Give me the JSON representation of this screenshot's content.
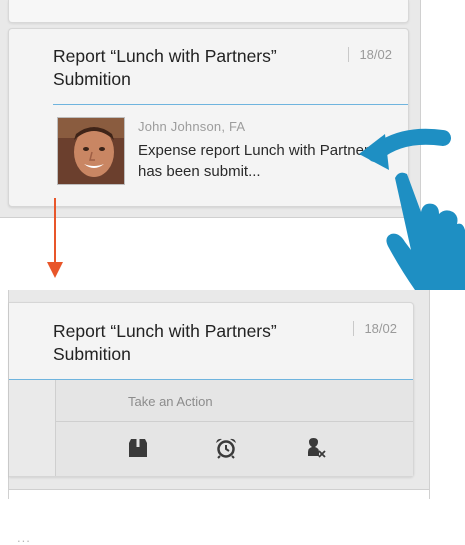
{
  "card_title": "Report “Lunch with Partners” Submition",
  "card_date": "18/02",
  "sender": "John Johnson, FA",
  "message": "Expense report Lunch with Partners has been submit...",
  "actions_panel": {
    "title": "Take an Action",
    "overflow": "...",
    "buttons": [
      {
        "name": "archive-icon"
      },
      {
        "name": "alarm-clock-icon"
      },
      {
        "name": "remove-user-icon"
      }
    ]
  },
  "colors": {
    "accent_blue": "#6fb4de",
    "hand_blue": "#1e8fc3",
    "arrow_red": "#e8562a"
  }
}
